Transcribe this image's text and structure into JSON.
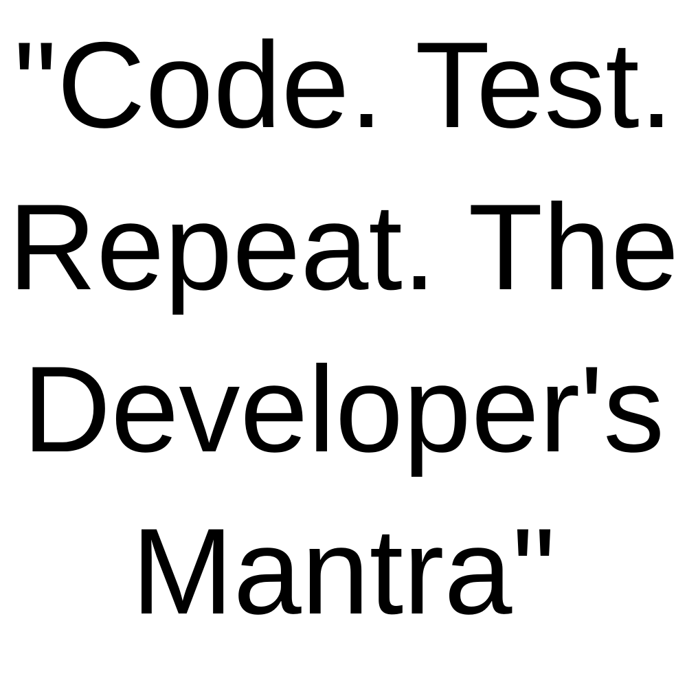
{
  "text": {
    "lines": [
      "\"Code. Test.",
      "Repeat. The",
      "Developer's",
      "Mantra\""
    ]
  },
  "colors": {
    "text": "#000000",
    "background": "#ffffff"
  }
}
